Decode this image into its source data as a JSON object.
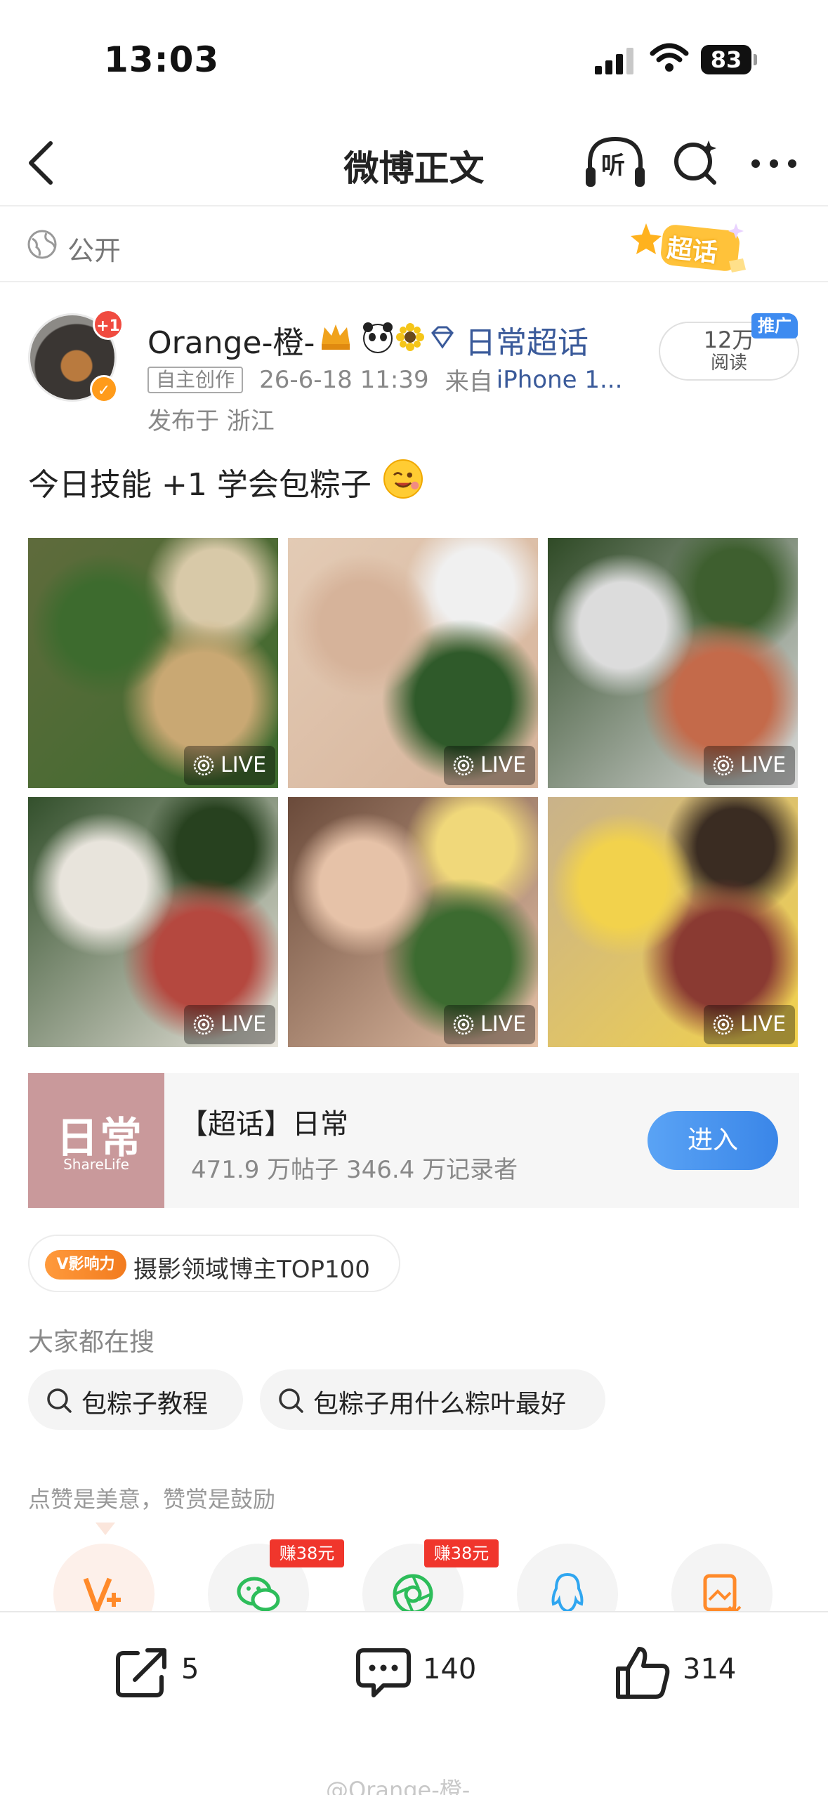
{
  "status_bar": {
    "time": "13:03",
    "battery": "83",
    "icons": [
      "signal-icon",
      "wifi-icon",
      "battery-icon"
    ]
  },
  "nav": {
    "title": "微博正文",
    "listen_label": "听",
    "icons": [
      "back-icon",
      "headphones-icon",
      "search-icon",
      "more-icon"
    ]
  },
  "visibility": {
    "label": "公开",
    "super_badge": "超话"
  },
  "author": {
    "name": "Orange-橙-",
    "avatar_badge": "+1",
    "topic_link": "日常超话",
    "original_tag": "自主创作",
    "time": "26-6-18 11:39",
    "source_prefix": "来自",
    "device": "iPhone 1...",
    "location": "发布于 浙江",
    "reads_count": "12万",
    "reads_label": "阅读",
    "promo_tag": "推广"
  },
  "post": {
    "text": "今日技能 +1 学会包粽子",
    "photos": [
      {
        "live": "LIVE",
        "colors": [
          "#5f6b3c",
          "#c9a873",
          "#3d6b2e",
          "#d8c9a8"
        ]
      },
      {
        "live": "LIVE",
        "colors": [
          "#e3cbb5",
          "#2f5a2a",
          "#d6b39a",
          "#f0f0f0"
        ]
      },
      {
        "live": "LIVE",
        "colors": [
          "#2f4a26",
          "#c46a4a",
          "#dcdcdc",
          "#3e5f2f"
        ]
      },
      {
        "live": "LIVE",
        "colors": [
          "#33502c",
          "#b5483f",
          "#e8e4dc",
          "#27411f"
        ]
      },
      {
        "live": "LIVE",
        "colors": [
          "#6a4a3a",
          "#3c6b30",
          "#e6c2a8",
          "#f0d87a"
        ]
      },
      {
        "live": "LIVE",
        "colors": [
          "#c9b28a",
          "#8a3a32",
          "#f2d24c",
          "#3a2c22"
        ]
      }
    ]
  },
  "topic_card": {
    "cover_title": "日常",
    "cover_sub": "ShareLife",
    "title": "【超话】日常",
    "stats": "471.9 万帖子 346.4 万记录者",
    "enter_label": "进入"
  },
  "influence": {
    "badge": "V影响力",
    "text": "摄影领域博主TOP100"
  },
  "searches": {
    "heading": "大家都在搜",
    "items": [
      "包粽子教程",
      "包粽子用什么粽叶最好"
    ]
  },
  "reward": {
    "heading": "点赞是美意，赞赏是鼓励",
    "earn_tags": [
      "赚38元",
      "赚38元"
    ],
    "icons": [
      "vip-icon",
      "wechat-icon",
      "moments-icon",
      "qq-icon",
      "save-image-icon"
    ]
  },
  "actions": {
    "share_count": "5",
    "comment_count": "140",
    "like_count": "314",
    "watermark": "@Orange-橙-"
  },
  "colors": {
    "link": "#3a5a9a",
    "accent_blue": "#3a86e8",
    "earn_red": "#f0362c",
    "influence_orange": "#f27b1e"
  }
}
